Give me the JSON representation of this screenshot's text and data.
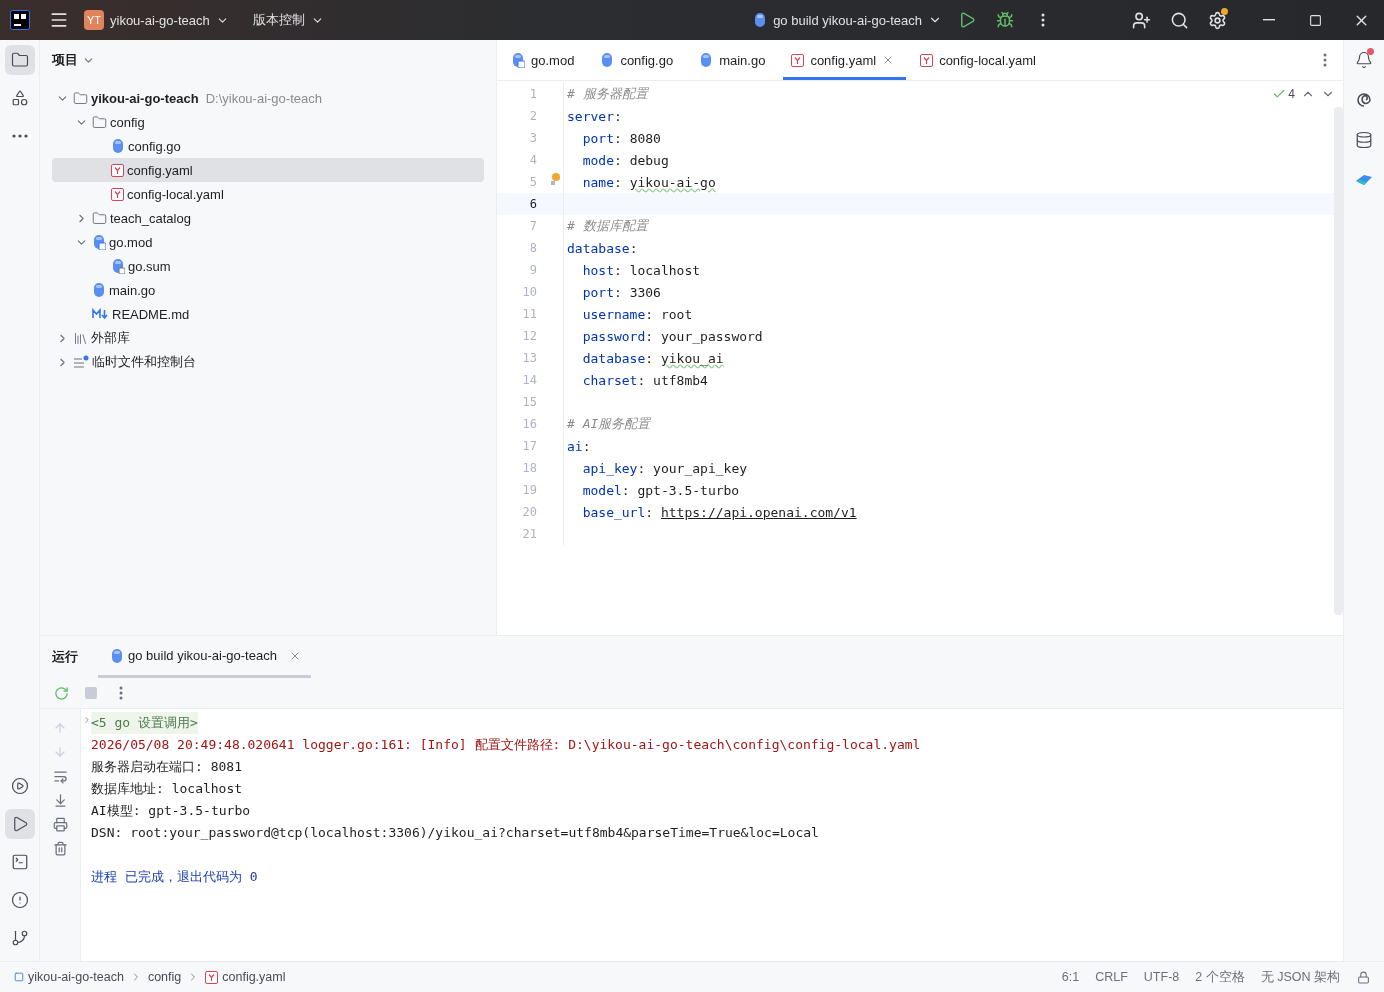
{
  "title_bar": {
    "project_badge": "YT",
    "project_name": "yikou-ai-go-teach",
    "vcs_menu": "版本控制",
    "run_config": "go build yikou-ai-go-teach",
    "settings_badge": true
  },
  "project_panel": {
    "title": "项目",
    "tree": [
      {
        "label": "yikou-ai-go-teach",
        "path": "D:\\yikou-ai-go-teach",
        "kind": "folder",
        "expanded": true,
        "selected": false,
        "children": [
          {
            "label": "config",
            "kind": "folder",
            "expanded": true,
            "selected": false,
            "children": [
              {
                "label": "config.go",
                "kind": "go",
                "selected": false
              },
              {
                "label": "config.yaml",
                "kind": "yaml",
                "selected": true
              },
              {
                "label": "config-local.yaml",
                "kind": "yaml",
                "selected": false
              }
            ]
          },
          {
            "label": "teach_catalog",
            "kind": "folder",
            "expanded": false,
            "selected": false
          },
          {
            "label": "go.mod",
            "kind": "gomod",
            "expanded": true,
            "selected": false,
            "children": [
              {
                "label": "go.sum",
                "kind": "gosum",
                "selected": false
              }
            ]
          },
          {
            "label": "main.go",
            "kind": "go",
            "selected": false
          },
          {
            "label": "README.md",
            "kind": "md",
            "selected": false
          }
        ]
      },
      {
        "label": "外部库",
        "kind": "library",
        "expanded": false,
        "selected": false
      },
      {
        "label": "临时文件和控制台",
        "kind": "scratch",
        "expanded": false,
        "selected": false
      }
    ]
  },
  "editor": {
    "tabs": [
      {
        "label": "go.mod",
        "kind": "gomod",
        "selected": false
      },
      {
        "label": "config.go",
        "kind": "go",
        "selected": false
      },
      {
        "label": "main.go",
        "kind": "go",
        "selected": false
      },
      {
        "label": "config.yaml",
        "kind": "yaml",
        "selected": true
      },
      {
        "label": "config-local.yaml",
        "kind": "yaml",
        "selected": false
      }
    ],
    "inspection_count": "4",
    "lines": [
      {
        "number": "1",
        "current": false,
        "hint": false,
        "parts": [
          {
            "kind": "comment",
            "text": "# 服务器配置"
          }
        ]
      },
      {
        "number": "2",
        "current": false,
        "hint": false,
        "parts": [
          {
            "kind": "key",
            "text": "server"
          },
          {
            "kind": "punct",
            "text": ":"
          }
        ]
      },
      {
        "number": "3",
        "current": false,
        "hint": false,
        "parts": [
          {
            "kind": "key",
            "text": "  port"
          },
          {
            "kind": "punct",
            "text": ": "
          },
          {
            "kind": "value",
            "text": "8080"
          }
        ]
      },
      {
        "number": "4",
        "current": false,
        "hint": false,
        "parts": [
          {
            "kind": "key",
            "text": "  mode"
          },
          {
            "kind": "punct",
            "text": ": "
          },
          {
            "kind": "value",
            "text": "debug"
          }
        ]
      },
      {
        "number": "5",
        "current": false,
        "hint": true,
        "parts": [
          {
            "kind": "key",
            "text": "  name"
          },
          {
            "kind": "punct",
            "text": ": "
          },
          {
            "kind": "typo",
            "text": "yikou-ai-go"
          }
        ]
      },
      {
        "number": "6",
        "current": true,
        "hint": false
      },
      {
        "number": "7",
        "current": false,
        "hint": false,
        "parts": [
          {
            "kind": "comment",
            "text": "# 数据库配置"
          }
        ]
      },
      {
        "number": "8",
        "current": false,
        "hint": false,
        "parts": [
          {
            "kind": "key",
            "text": "database"
          },
          {
            "kind": "punct",
            "text": ":"
          }
        ]
      },
      {
        "number": "9",
        "current": false,
        "hint": false,
        "parts": [
          {
            "kind": "key",
            "text": "  host"
          },
          {
            "kind": "punct",
            "text": ": "
          },
          {
            "kind": "value",
            "text": "localhost"
          }
        ]
      },
      {
        "number": "10",
        "current": false,
        "hint": false,
        "parts": [
          {
            "kind": "key",
            "text": "  port"
          },
          {
            "kind": "punct",
            "text": ": "
          },
          {
            "kind": "value",
            "text": "3306"
          }
        ]
      },
      {
        "number": "11",
        "current": false,
        "hint": false,
        "parts": [
          {
            "kind": "key",
            "text": "  username"
          },
          {
            "kind": "punct",
            "text": ": "
          },
          {
            "kind": "value",
            "text": "root"
          }
        ]
      },
      {
        "number": "12",
        "current": false,
        "hint": false,
        "parts": [
          {
            "kind": "key",
            "text": "  password"
          },
          {
            "kind": "punct",
            "text": ": "
          },
          {
            "kind": "value",
            "text": "your_password"
          }
        ]
      },
      {
        "number": "13",
        "current": false,
        "hint": false,
        "parts": [
          {
            "kind": "key",
            "text": "  database"
          },
          {
            "kind": "punct",
            "text": ": "
          },
          {
            "kind": "typo",
            "text": "yikou_ai"
          }
        ]
      },
      {
        "number": "14",
        "current": false,
        "hint": false,
        "parts": [
          {
            "kind": "key",
            "text": "  charset"
          },
          {
            "kind": "punct",
            "text": ": "
          },
          {
            "kind": "value",
            "text": "utf8mb4"
          }
        ]
      },
      {
        "number": "15",
        "current": false,
        "hint": false
      },
      {
        "number": "16",
        "current": false,
        "hint": false,
        "parts": [
          {
            "kind": "comment",
            "text": "# AI服务配置"
          }
        ]
      },
      {
        "number": "17",
        "current": false,
        "hint": false,
        "parts": [
          {
            "kind": "key",
            "text": "ai"
          },
          {
            "kind": "punct",
            "text": ":"
          }
        ]
      },
      {
        "number": "18",
        "current": false,
        "hint": false,
        "parts": [
          {
            "kind": "key",
            "text": "  api_key"
          },
          {
            "kind": "punct",
            "text": ": "
          },
          {
            "kind": "value",
            "text": "your_api_key"
          }
        ]
      },
      {
        "number": "19",
        "current": false,
        "hint": false,
        "parts": [
          {
            "kind": "key",
            "text": "  model"
          },
          {
            "kind": "punct",
            "text": ": "
          },
          {
            "kind": "value",
            "text": "gpt-3.5-turbo"
          }
        ]
      },
      {
        "number": "20",
        "current": false,
        "hint": false,
        "parts": [
          {
            "kind": "key",
            "text": "  base_url"
          },
          {
            "kind": "punct",
            "text": ": "
          },
          {
            "kind": "url",
            "text": "https://api.openai.com/v1"
          }
        ]
      },
      {
        "number": "21",
        "current": false,
        "hint": false
      }
    ]
  },
  "run_panel": {
    "title": "运行",
    "tab": "go build yikou-ai-go-teach",
    "output": [
      {
        "kind": "folded",
        "text": "<5 go 设置调用>"
      },
      {
        "kind": "log",
        "text": "2026/05/08 20:49:48.020641 logger.go:161: [Info] 配置文件路径: D:\\yikou-ai-go-teach\\config\\config-local.yaml"
      },
      {
        "kind": "plain",
        "text": "服务器启动在端口: 8081"
      },
      {
        "kind": "plain",
        "text": "数据库地址: localhost"
      },
      {
        "kind": "plain",
        "text": "AI模型: gpt-3.5-turbo"
      },
      {
        "kind": "plain",
        "text": "DSN: root:your_password@tcp(localhost:3306)/yikou_ai?charset=utf8mb4&parseTime=True&loc=Local"
      },
      {
        "kind": "exit",
        "text": "进程 已完成，退出代码为 0"
      }
    ]
  },
  "status_bar": {
    "breadcrumbs": [
      {
        "label": "yikou-ai-go-teach",
        "kind": "module"
      },
      {
        "label": "config",
        "kind": "folder"
      },
      {
        "label": "config.yaml",
        "kind": "yaml"
      }
    ],
    "items": [
      "6:1",
      "CRLF",
      "UTF-8",
      "2 个空格",
      "无 JSON 架构"
    ]
  },
  "left_strip": [
    {
      "kind": "project",
      "selected": true
    },
    {
      "kind": "structure",
      "selected": false
    },
    {
      "kind": "more",
      "selected": false
    }
  ],
  "left_strip_bottom": [
    {
      "kind": "services",
      "selected": false
    },
    {
      "kind": "run",
      "selected": true
    },
    {
      "kind": "terminal",
      "selected": false
    },
    {
      "kind": "problems",
      "selected": false
    },
    {
      "kind": "git",
      "selected": false
    }
  ],
  "notifications_badge": true
}
